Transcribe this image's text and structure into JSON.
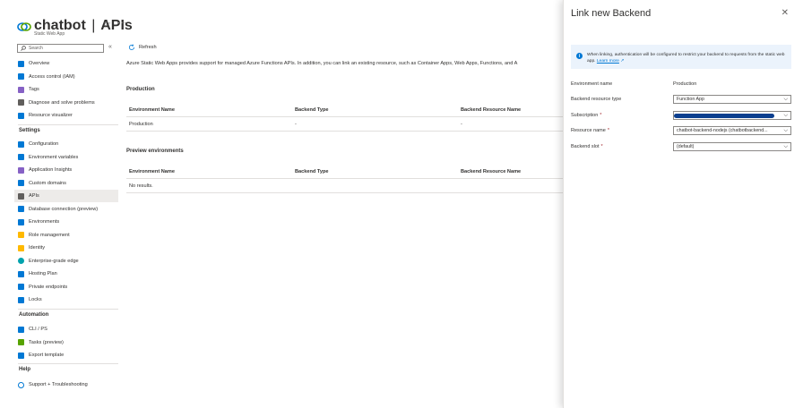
{
  "header": {
    "resource_name": "chatbot",
    "separator": "|",
    "page_name": "APIs",
    "subtitle": "Static Web App",
    "star_icon": "star-icon",
    "more_icon": "ellipsis-icon"
  },
  "sidebar": {
    "search_placeholder": "Search",
    "top_items": [
      {
        "label": "Overview",
        "icon": "overview-icon",
        "color": "#0078d4"
      },
      {
        "label": "Access control (IAM)",
        "icon": "people-icon",
        "color": "#0078d4"
      },
      {
        "label": "Tags",
        "icon": "tag-icon",
        "color": "#8661c5"
      },
      {
        "label": "Diagnose and solve problems",
        "icon": "wrench-icon",
        "color": "#605e5c"
      },
      {
        "label": "Resource visualizer",
        "icon": "network-icon",
        "color": "#0078d4"
      }
    ],
    "settings_title": "Settings",
    "settings_items": [
      {
        "label": "Configuration",
        "icon": "sliders-icon",
        "color": "#0078d4"
      },
      {
        "label": "Environment variables",
        "icon": "braces-icon",
        "color": "#0078d4"
      },
      {
        "label": "Application Insights",
        "icon": "bulb-icon",
        "color": "#8661c5"
      },
      {
        "label": "Custom domains",
        "icon": "domain-icon",
        "color": "#0078d4"
      },
      {
        "label": "APIs",
        "icon": "api-icon",
        "color": "#605e5c"
      },
      {
        "label": "Database connection (preview)",
        "icon": "database-icon",
        "color": "#0078d4"
      },
      {
        "label": "Environments",
        "icon": "environment-icon",
        "color": "#0078d4"
      },
      {
        "label": "Role management",
        "icon": "key-icon",
        "color": "#ffb900"
      },
      {
        "label": "Identity",
        "icon": "identity-icon",
        "color": "#ffb900"
      },
      {
        "label": "Enterprise-grade edge",
        "icon": "globe-icon",
        "color": "#00a2ad"
      },
      {
        "label": "Hosting Plan",
        "icon": "edit-icon",
        "color": "#0078d4"
      },
      {
        "label": "Private endpoints",
        "icon": "endpoint-icon",
        "color": "#0078d4"
      },
      {
        "label": "Locks",
        "icon": "lock-icon",
        "color": "#0078d4"
      }
    ],
    "automation_title": "Automation",
    "automation_items": [
      {
        "label": "CLI / PS",
        "icon": "terminal-icon",
        "color": "#0078d4"
      },
      {
        "label": "Tasks (preview)",
        "icon": "tasks-icon",
        "color": "#57a300"
      },
      {
        "label": "Export template",
        "icon": "export-icon",
        "color": "#0078d4"
      }
    ],
    "help_title": "Help",
    "help_items": [
      {
        "label": "Support + Troubleshooting",
        "icon": "help-icon",
        "color": "#0078d4"
      }
    ]
  },
  "main": {
    "refresh_label": "Refresh",
    "description": "Azure Static Web Apps provides support for managed Azure Functions APIs. In addition, you can link an existing resource, such as Container Apps, Web Apps, Functions, and A",
    "production": {
      "title": "Production",
      "columns": [
        "Environment Name",
        "Backend Type",
        "Backend Resource Name"
      ],
      "rows": [
        [
          "Production",
          "-",
          "-"
        ]
      ]
    },
    "preview": {
      "title": "Preview environments",
      "columns": [
        "Environment Name",
        "Backend Type",
        "Backend Resource Name"
      ],
      "empty": "No results."
    }
  },
  "blade": {
    "title": "Link new Backend",
    "info_text": "When linking, authentication will be configured to restrict your backend to requests from the static web app.",
    "info_link": "Learn more",
    "fields": {
      "environment_name": {
        "label": "Environment name",
        "value": "Production"
      },
      "backend_resource_type": {
        "label": "Backend resource type",
        "value": "Function App"
      },
      "subscription": {
        "label": "Subscription",
        "required": "*"
      },
      "resource_name": {
        "label": "Resource name",
        "required": "*",
        "value": "chatbot-backend-nodejs (chatbotbackend..."
      },
      "backend_slot": {
        "label": "Backend slot",
        "required": "*",
        "value": "(default)"
      }
    }
  }
}
